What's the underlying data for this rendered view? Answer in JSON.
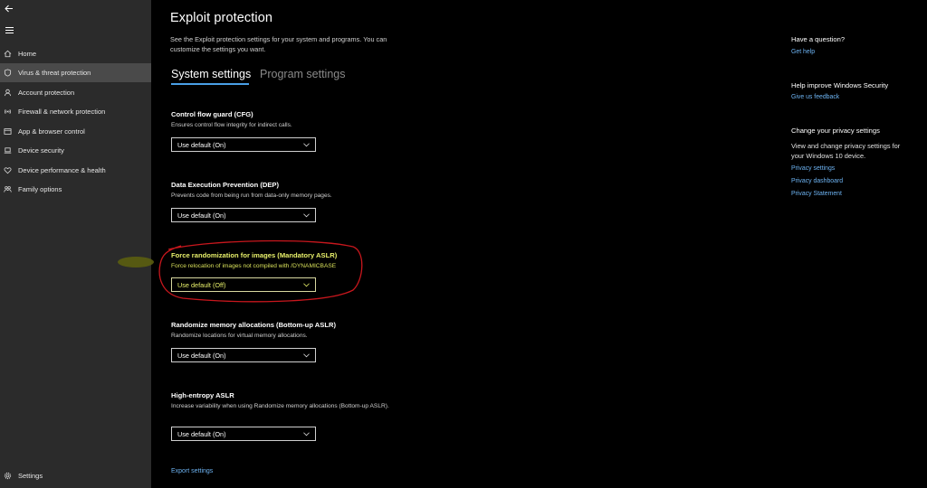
{
  "sidebar": {
    "items": [
      {
        "label": "Home",
        "icon": "home-icon"
      },
      {
        "label": "Virus & threat protection",
        "icon": "shield-icon",
        "selected": true
      },
      {
        "label": "Account protection",
        "icon": "person-icon"
      },
      {
        "label": "Firewall & network protection",
        "icon": "wifi-icon"
      },
      {
        "label": "App & browser control",
        "icon": "window-icon"
      },
      {
        "label": "Device security",
        "icon": "laptop-icon"
      },
      {
        "label": "Device performance & health",
        "icon": "heart-icon"
      },
      {
        "label": "Family options",
        "icon": "family-icon"
      }
    ],
    "settings_label": "Settings"
  },
  "main": {
    "title": "Exploit protection",
    "description": "See the Exploit protection settings for your system and programs.  You can customize the settings you want.",
    "tabs": [
      "System settings",
      "Program settings"
    ],
    "settings": [
      {
        "title": "Control flow guard (CFG)",
        "desc": "Ensures control flow integrity for indirect calls.",
        "value": "Use default (On)"
      },
      {
        "title": "Data Execution Prevention (DEP)",
        "desc": "Prevents code from being run from data-only memory pages.",
        "value": "Use default (On)"
      },
      {
        "title": "Force randomization for images (Mandatory ASLR)",
        "desc": "Force relocation of images not compiled with /DYNAMICBASE",
        "value": "Use default (Off)"
      },
      {
        "title": "Randomize memory allocations (Bottom-up ASLR)",
        "desc": "Randomize locations for virtual memory allocations.",
        "value": "Use default (On)"
      },
      {
        "title": "High-entropy ASLR",
        "desc": "Increase variability when using Randomize memory allocations (Bottom-up ASLR).",
        "value": "Use default (On)"
      }
    ],
    "export_link": "Export settings"
  },
  "right": {
    "question_heading": "Have a question?",
    "get_help": "Get help",
    "improve_heading": "Help improve Windows Security",
    "feedback": "Give us feedback",
    "privacy_heading": "Change your privacy settings",
    "privacy_text": "View and change privacy settings for your Windows 10 device.",
    "privacy_settings": "Privacy settings",
    "privacy_dashboard": "Privacy dashboard",
    "privacy_statement": "Privacy Statement"
  },
  "colors": {
    "accent_link": "#6db3f2",
    "highlight_text": "#e8f06a",
    "annotation_red": "#c8171d",
    "sidebar_bg": "#2b2b2b"
  }
}
